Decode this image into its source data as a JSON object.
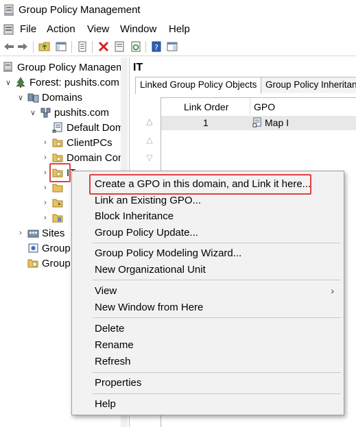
{
  "window": {
    "title": "Group Policy Management"
  },
  "menu": {
    "items": [
      "File",
      "Action",
      "View",
      "Window",
      "Help"
    ]
  },
  "toolbar": {
    "icons": [
      "back-arrow-icon",
      "forward-arrow-icon",
      "up-folder-icon",
      "show-hide-tree-icon",
      "export-list-icon",
      "delete-icon",
      "properties-icon",
      "refresh-icon",
      "help-icon",
      "show-pane-icon"
    ]
  },
  "tree": {
    "root": "Group Policy Manageme",
    "forest": "Forest: pushits.com",
    "domains": "Domains",
    "domain": "pushits.com",
    "default_policy": "Default Dom",
    "client_pcs": "ClientPCs",
    "domain_controllers": "Domain Con",
    "it_ou": "IT",
    "sites": "Sites",
    "gp_modeling": "Group",
    "gp_results": "Group"
  },
  "right_pane": {
    "title": "IT",
    "tabs": [
      "Linked Group Policy Objects",
      "Group Policy Inheritanc"
    ],
    "columns": {
      "link_order": "Link Order",
      "gpo": "GPO"
    },
    "rows": [
      {
        "link_order": "1",
        "gpo": "Map I"
      }
    ]
  },
  "context_menu": {
    "create_gpo": "Create a GPO in this domain, and Link it here...",
    "link_existing": "Link an Existing GPO...",
    "block_inheritance": "Block Inheritance",
    "gp_update": "Group Policy Update...",
    "modeling_wizard": "Group Policy Modeling Wizard...",
    "new_ou": "New Organizational Unit",
    "view": "View",
    "new_window": "New Window from Here",
    "delete": "Delete",
    "rename": "Rename",
    "refresh": "Refresh",
    "properties": "Properties",
    "help": "Help"
  },
  "colors": {
    "highlight_border": "#e04040",
    "menu_bg": "#f2f2f2",
    "selected_row": "#e8e8e8"
  }
}
